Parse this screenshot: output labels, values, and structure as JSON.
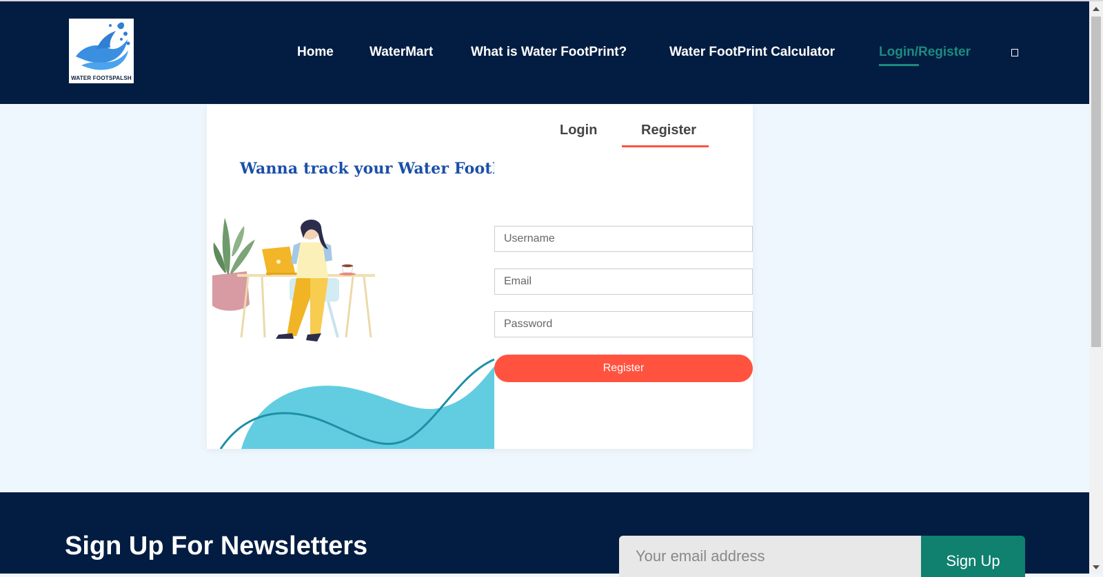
{
  "brand": {
    "logo_text": "WATER FOOTSPALSH"
  },
  "nav": {
    "items": [
      {
        "label": "Home"
      },
      {
        "label": "WaterMart"
      },
      {
        "label": "What is Water FootPrint?"
      },
      {
        "label": "Water FootPrint Calculator"
      },
      {
        "label": "Login/Register",
        "active": true
      }
    ],
    "extra_icon": "square-icon"
  },
  "auth": {
    "tagline": "Wanna track your Water FootPrint",
    "tabs": [
      {
        "label": "Login"
      },
      {
        "label": "Register",
        "active": true
      }
    ],
    "fields": {
      "username_placeholder": "Username",
      "email_placeholder": "Email",
      "password_placeholder": "Password"
    },
    "submit_label": "Register"
  },
  "newsletter": {
    "title": "Sign Up For Newsletters",
    "email_placeholder": "Your email address",
    "button_label": "Sign Up"
  },
  "colors": {
    "header_bg": "#031d42",
    "accent_teal": "#1d8c80",
    "accent_red": "#ff5340",
    "page_bg": "#eef6fe"
  }
}
